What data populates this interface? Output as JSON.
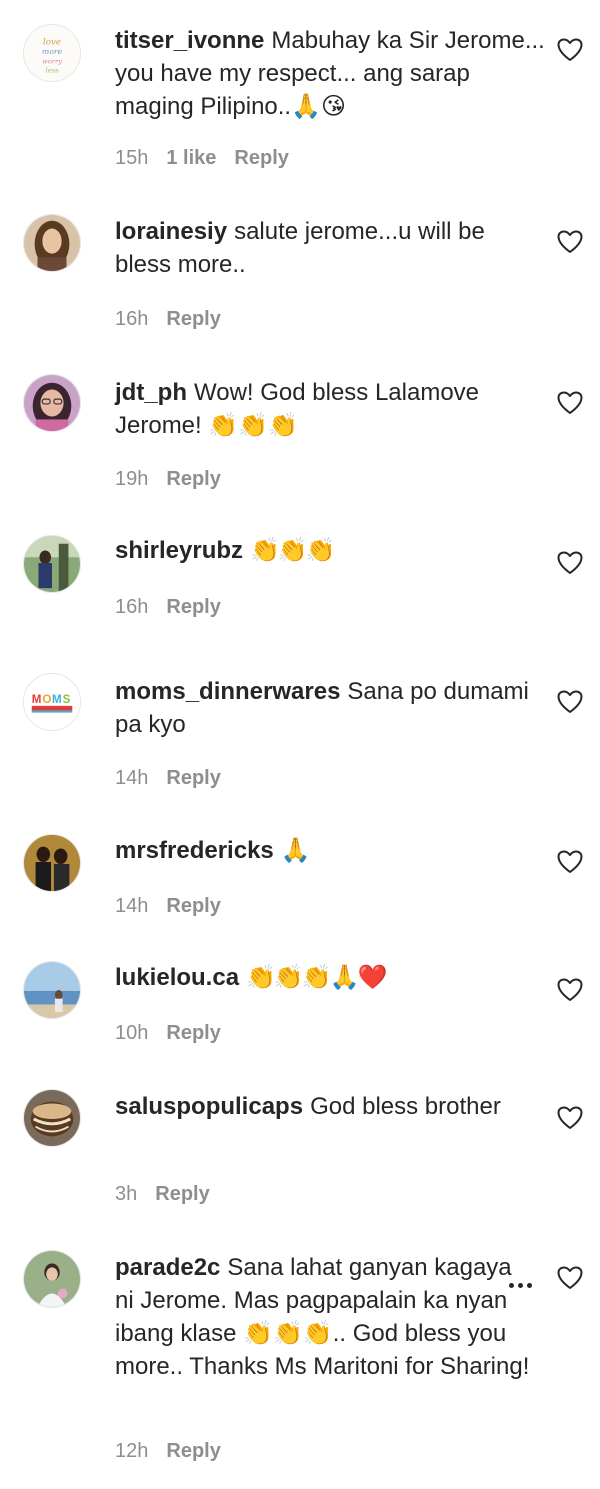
{
  "comments": [
    {
      "username": "titser_ivonne",
      "text": "Mabuhay ka Sir Jerome... you have my respect... ang sarap maging Pilipino..🙏😘",
      "time": "15h",
      "likes": "1 like",
      "reply": "Reply"
    },
    {
      "username": "lorainesiy",
      "text": "salute jerome...u will be bless more..",
      "time": "16h",
      "reply": "Reply"
    },
    {
      "username": "jdt_ph",
      "text": "Wow! God bless Lalamove Jerome! 👏👏👏",
      "time": "19h",
      "reply": "Reply"
    },
    {
      "username": "shirleyrubz",
      "text": "👏👏👏",
      "time": "16h",
      "reply": "Reply"
    },
    {
      "username": "moms_dinnerwares",
      "text": "Sana po dumami pa kyo",
      "time": "14h",
      "reply": "Reply"
    },
    {
      "username": "mrsfredericks",
      "text": "🙏",
      "time": "14h",
      "reply": "Reply"
    },
    {
      "username": "lukielou.ca",
      "text": "👏👏👏🙏❤️",
      "time": "10h",
      "reply": "Reply"
    },
    {
      "username": "saluspopulicaps",
      "text": "God bless brother",
      "time": "3h",
      "reply": "Reply"
    },
    {
      "username": "parade2c",
      "text": "Sana lahat ganyan kagaya ni Jerome. Mas pagpapalain ka nyan ibang klase 👏👏👏.. God bless you more.. Thanks Ms Maritoni for Sharing!",
      "time": "12h",
      "reply": "Reply"
    }
  ],
  "icons": {
    "like": "heart-outline-icon",
    "options": "more-horizontal-icon"
  },
  "colors": {
    "text": "#262626",
    "secondary": "#8e8e8e"
  }
}
